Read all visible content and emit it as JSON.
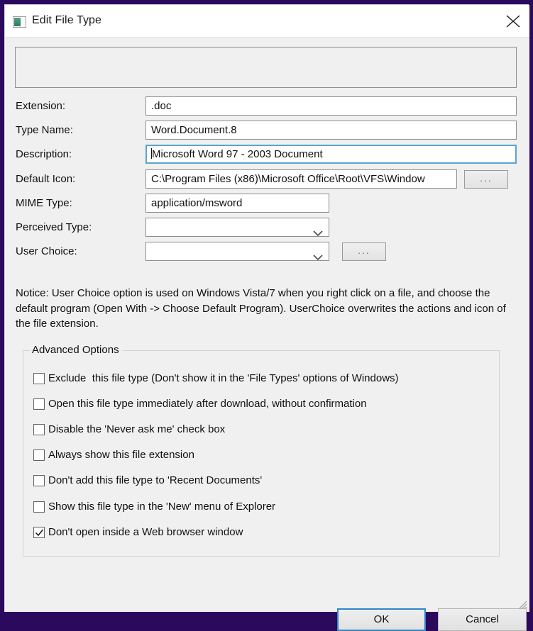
{
  "window": {
    "title": "Edit File Type",
    "icon": "file-type-icon",
    "close_icon": "close-icon",
    "frame_color": "#2b0a5e",
    "background_color": "#f0f0f0",
    "focus_border_color": "#5ba4cf"
  },
  "preview_panel": {
    "content": ""
  },
  "fields": [
    {
      "label": "Extension:",
      "name": "extension",
      "value": ".doc",
      "control": "text",
      "width": "wide",
      "focused": false,
      "browse_button": null
    },
    {
      "label": "Type Name:",
      "name": "type-name",
      "value": "Word.Document.8",
      "control": "text",
      "width": "wide",
      "focused": false,
      "browse_button": null
    },
    {
      "label": "Description:",
      "name": "description",
      "value": "Microsoft Word 97 - 2003 Document",
      "control": "text",
      "width": "wide",
      "focused": true,
      "browse_button": null
    },
    {
      "label": "Default Icon:",
      "name": "default-icon",
      "value": "C:\\Program Files (x86)\\Microsoft Office\\Root\\VFS\\Window",
      "control": "text",
      "width": "medium",
      "focused": false,
      "browse_button": "..."
    },
    {
      "label": "MIME Type:",
      "name": "mime-type",
      "value": "application/msword",
      "control": "text",
      "width": "narrow",
      "focused": false,
      "browse_button": null
    },
    {
      "label": "Perceived Type:",
      "name": "perceived-type",
      "value": "",
      "control": "combo",
      "width": "narrow",
      "focused": false,
      "browse_button": null
    },
    {
      "label": "User Choice:",
      "name": "user-choice",
      "value": "",
      "control": "combo",
      "width": "narrow",
      "focused": false,
      "browse_button": "..."
    }
  ],
  "notice": {
    "text": "Notice: User Choice option is used on Windows Vista/7 when you right click on a file, and choose the default program (Open With -> Choose Default Program). UserChoice overwrites the actions and icon of the file extension."
  },
  "advanced_options": {
    "legend": "Advanced Options",
    "checkboxes": [
      {
        "name": "exclude-file-type",
        "label": "Exclude  this file type (Don't show it in the 'File Types' options of Windows)",
        "checked": false
      },
      {
        "name": "open-immediately",
        "label": "Open this file type immediately after download, without confirmation",
        "checked": false
      },
      {
        "name": "disable-never-ask-me",
        "label": "Disable the 'Never ask me' check box",
        "checked": false
      },
      {
        "name": "always-show-extension",
        "label": "Always show this file extension",
        "checked": false
      },
      {
        "name": "no-recent-documents",
        "label": "Don't add this file type to 'Recent Documents'",
        "checked": false
      },
      {
        "name": "show-in-new-menu",
        "label": "Show this file type in the 'New' menu of Explorer",
        "checked": false
      },
      {
        "name": "no-web-browser-window",
        "label": "Don't open inside a Web browser window",
        "checked": true
      }
    ]
  },
  "footer": {
    "ok_label": "OK",
    "cancel_label": "Cancel",
    "default_button": "OK"
  }
}
